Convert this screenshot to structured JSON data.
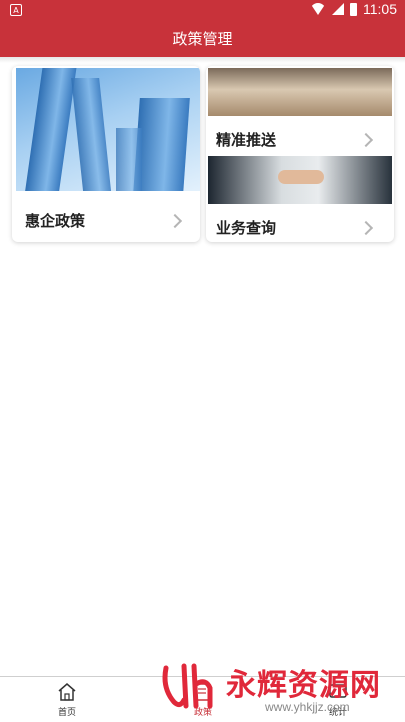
{
  "status_bar": {
    "time": "11:05",
    "left_icon_letter": "A"
  },
  "header": {
    "title": "政策管理",
    "color": "#c8323a"
  },
  "cards": [
    {
      "label": "惠企政策",
      "image": "city-skyscraper-image",
      "icon": "chevron-right-icon"
    },
    {
      "label": "精准推送",
      "image": "office-photo-image",
      "icon": "chevron-right-icon"
    },
    {
      "label": "业务查询",
      "image": "handshake-photo-image",
      "icon": "chevron-right-icon"
    }
  ],
  "bottom_nav": {
    "items": [
      {
        "label": "首页",
        "icon": "home-icon"
      },
      {
        "label": "政策",
        "icon": "policy-icon"
      },
      {
        "label": "统计",
        "icon": "chart-icon"
      }
    ]
  },
  "watermark": {
    "title": "永辉资源网",
    "url": "www.yhkjjz.com",
    "color": "#e0283a"
  }
}
